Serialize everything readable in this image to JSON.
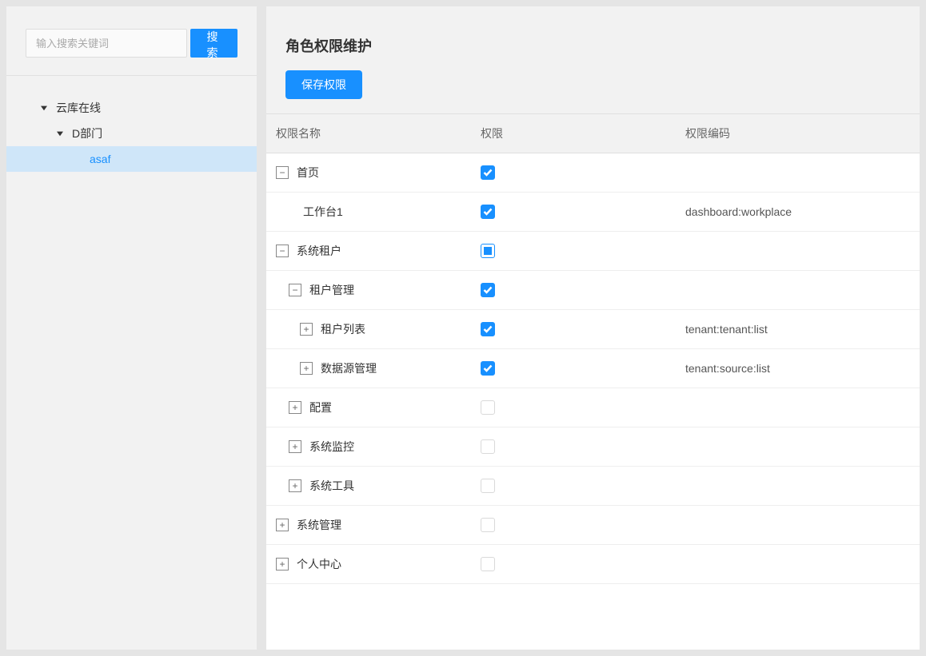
{
  "sidebar": {
    "search": {
      "placeholder": "输入搜索关键词",
      "button": "搜 索"
    },
    "tree": [
      {
        "level": 0,
        "label": "云库在线",
        "expanded": true,
        "selected": false
      },
      {
        "level": 1,
        "label": "D部门",
        "expanded": true,
        "selected": false
      },
      {
        "level": 2,
        "label": "asaf",
        "expanded": false,
        "selected": true
      }
    ]
  },
  "main": {
    "title": "角色权限维护",
    "save_label": "保存权限",
    "table": {
      "headers": {
        "name": "权限名称",
        "perm": "权限",
        "code": "权限编码"
      },
      "rows": [
        {
          "indent": 0,
          "expander": "-",
          "label": "首页",
          "state": "checked",
          "code": ""
        },
        {
          "indent": 1,
          "expander": "",
          "label": "工作台1",
          "state": "checked",
          "code": "dashboard:workplace"
        },
        {
          "indent": 0,
          "expander": "-",
          "label": "系统租户",
          "state": "indeterminate",
          "code": ""
        },
        {
          "indent": 1,
          "expander": "-",
          "label": "租户管理",
          "state": "checked",
          "code": ""
        },
        {
          "indent": 2,
          "expander": "+",
          "label": "租户列表",
          "state": "checked",
          "code": "tenant:tenant:list"
        },
        {
          "indent": 2,
          "expander": "+",
          "label": "数据源管理",
          "state": "checked",
          "code": "tenant:source:list"
        },
        {
          "indent": 1,
          "expander": "+",
          "label": "配置",
          "state": "unchecked",
          "code": ""
        },
        {
          "indent": 1,
          "expander": "+",
          "label": "系统监控",
          "state": "unchecked",
          "code": ""
        },
        {
          "indent": 1,
          "expander": "+",
          "label": "系统工具",
          "state": "unchecked",
          "code": ""
        },
        {
          "indent": 0,
          "expander": "+",
          "label": "系统管理",
          "state": "unchecked",
          "code": ""
        },
        {
          "indent": 0,
          "expander": "+",
          "label": "个人中心",
          "state": "unchecked",
          "code": ""
        }
      ]
    }
  }
}
